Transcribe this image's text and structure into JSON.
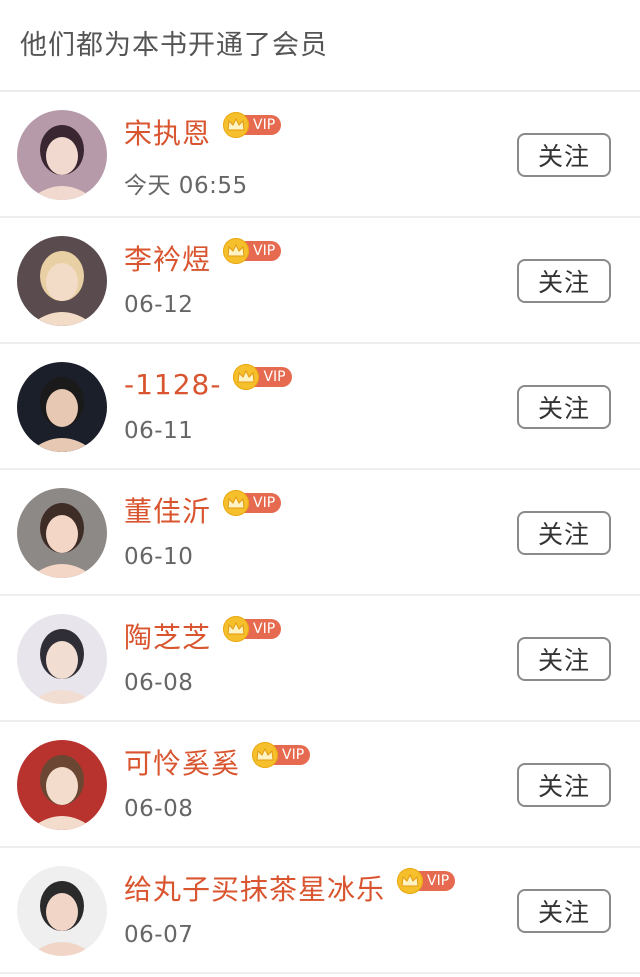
{
  "header": {
    "title": "他们都为本书开通了会员"
  },
  "vip_label": "VIP",
  "follow_label": "关注",
  "members": [
    {
      "name": "宋执恩",
      "date": "今天 06:55",
      "avatar_bg": "#b79aa9",
      "avatar_fg": "#f1d9cf",
      "hair": "#3a2630"
    },
    {
      "name": "李衿煜",
      "date": "06-12",
      "avatar_bg": "#5a4c4e",
      "avatar_fg": "#f3dcc7",
      "hair": "#e9cfa4"
    },
    {
      "name": "-1128-",
      "date": "06-11",
      "avatar_bg": "#1b1f2a",
      "avatar_fg": "#e7c8b2",
      "hair": "#1a1a1a"
    },
    {
      "name": "董佳沂",
      "date": "06-10",
      "avatar_bg": "#8d8987",
      "avatar_fg": "#f3d6c6",
      "hair": "#3e2c27"
    },
    {
      "name": "陶芝芝",
      "date": "06-08",
      "avatar_bg": "#e8e6ec",
      "avatar_fg": "#f2ddd3",
      "hair": "#2f2d35"
    },
    {
      "name": "可怜奚奚",
      "date": "06-08",
      "avatar_bg": "#b8332e",
      "avatar_fg": "#f4dccc",
      "hair": "#6b4733"
    },
    {
      "name": "给丸子买抹茶星冰乐",
      "date": "06-07",
      "avatar_bg": "#efefef",
      "avatar_fg": "#f1d6c8",
      "hair": "#2a2a2a"
    }
  ],
  "colors": {
    "name": "#d9552f",
    "vip_badge": "#e66a4f",
    "crown": "#f6c02c"
  },
  "icons": {
    "vip_badge_icon": "crown-icon"
  }
}
